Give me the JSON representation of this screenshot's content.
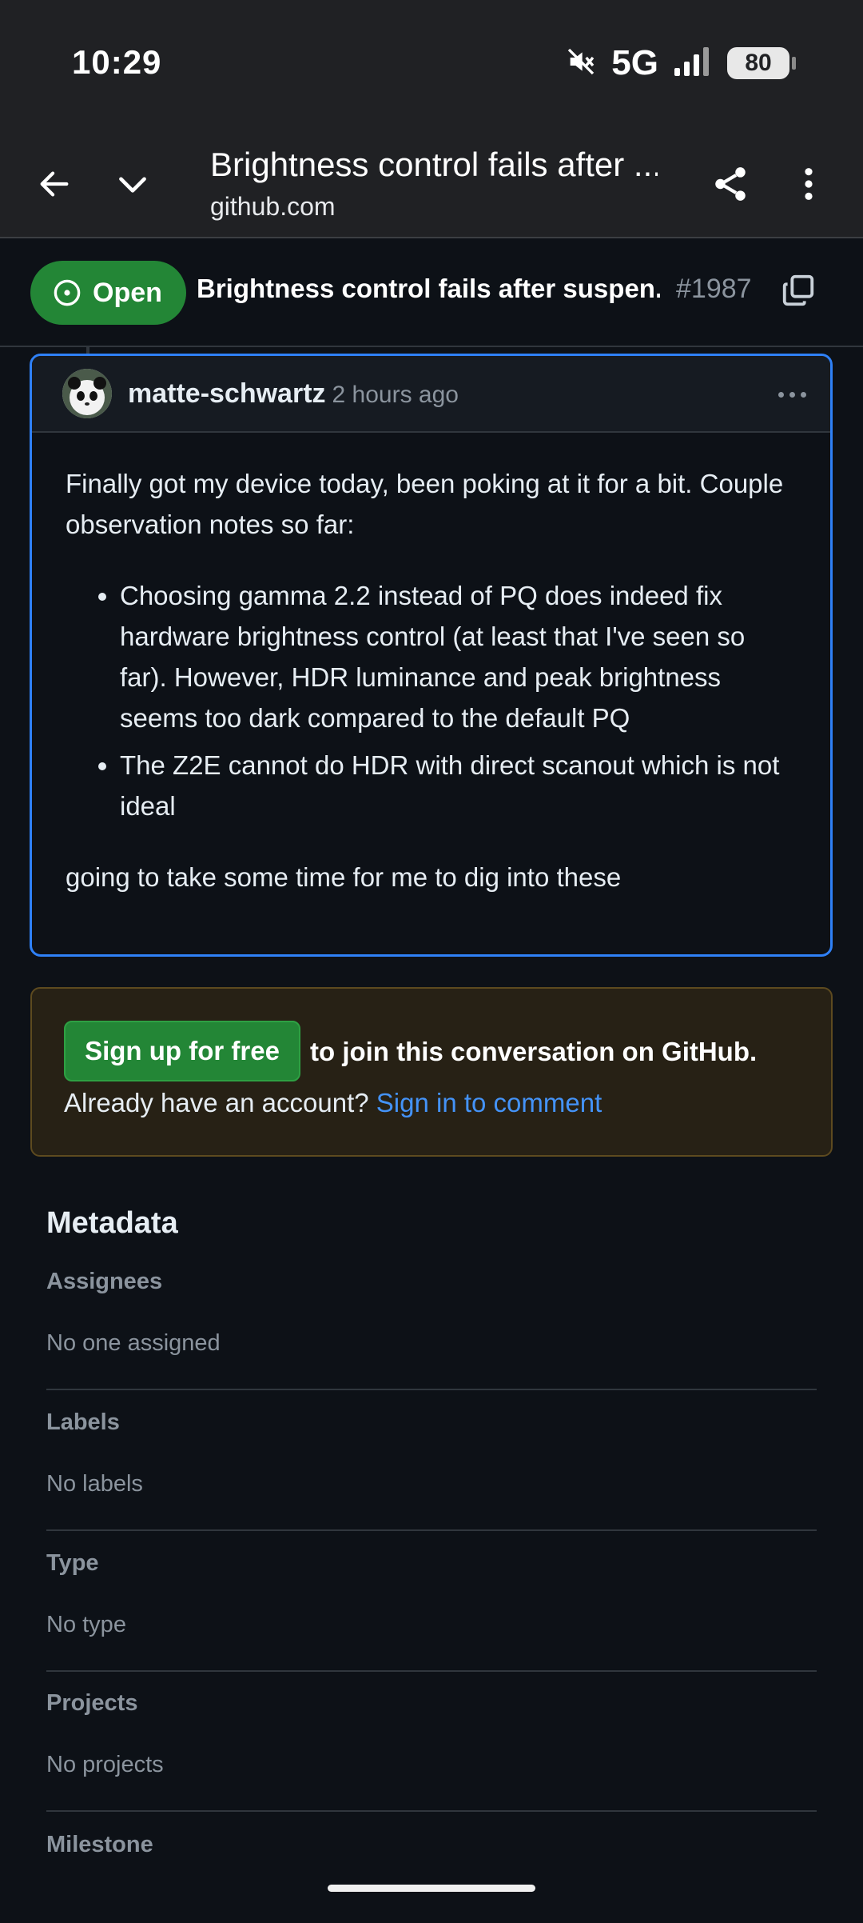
{
  "status_bar": {
    "time": "10:29",
    "network": "5G",
    "battery": "80"
  },
  "toolbar": {
    "title": "Brightness control fails after ...",
    "url": "github.com"
  },
  "issue": {
    "state": "Open",
    "title": "Brightness control fails after suspen...",
    "number": "#1987"
  },
  "comment": {
    "author": "matte-schwartz",
    "time_ago": "2 hours ago",
    "intro": "Finally got my device today, been poking at it for a bit. Couple observation notes so far:",
    "bullets": [
      "Choosing gamma 2.2 instead of PQ does indeed fix hardware brightness control (at least that I've seen so far). However, HDR luminance and peak brightness seems too dark compared to the default PQ",
      "The Z2E cannot do HDR with direct scanout which is not ideal"
    ],
    "outro": "going to take some time for me to dig into these"
  },
  "signup": {
    "button": "Sign up for free",
    "rest": "to join this conversation on GitHub.",
    "line2": "Already have an account?",
    "link": "Sign in to comment"
  },
  "metadata": {
    "title": "Metadata",
    "sections": [
      {
        "label": "Assignees",
        "value": "No one assigned"
      },
      {
        "label": "Labels",
        "value": "No labels"
      },
      {
        "label": "Type",
        "value": "No type"
      },
      {
        "label": "Projects",
        "value": "No projects"
      },
      {
        "label": "Milestone",
        "value": ""
      }
    ]
  },
  "colors": {
    "accent_green": "#238636",
    "focus_blue": "#2f81f7",
    "link_blue": "#4493f8"
  }
}
